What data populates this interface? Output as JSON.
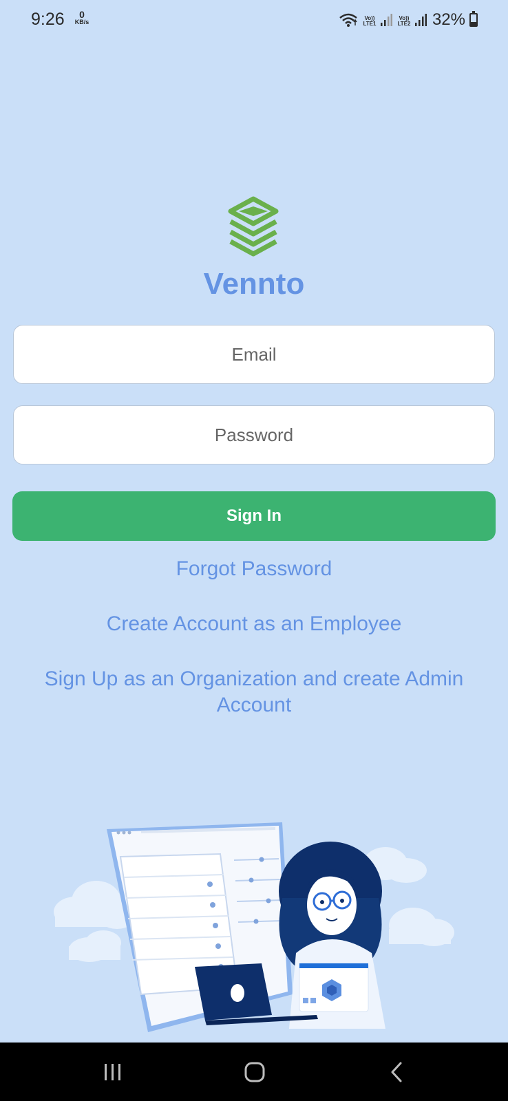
{
  "status_bar": {
    "time": "9:26",
    "data_rate": "0",
    "data_rate_unit": "KB/s",
    "sim1_label": "Vo)) LTE1",
    "sim2_label": "Vo)) LTE2",
    "battery_percent": "32%",
    "battery_level": 0.32
  },
  "app": {
    "name": "Vennto",
    "logo_color": "#6ab04c",
    "brand_color": "#6493e3"
  },
  "form": {
    "email_placeholder": "Email",
    "email_value": "",
    "password_placeholder": "Password",
    "password_value": "",
    "sign_in_label": "Sign In",
    "sign_in_color": "#3cb371"
  },
  "links": {
    "forgot_password": "Forgot Password",
    "create_employee": "Create Account as an Employee",
    "signup_org": "Sign Up as an Organization and create Admin Account"
  },
  "nav": {
    "recents_icon": "recents-icon",
    "home_icon": "home-icon",
    "back_icon": "back-icon"
  }
}
